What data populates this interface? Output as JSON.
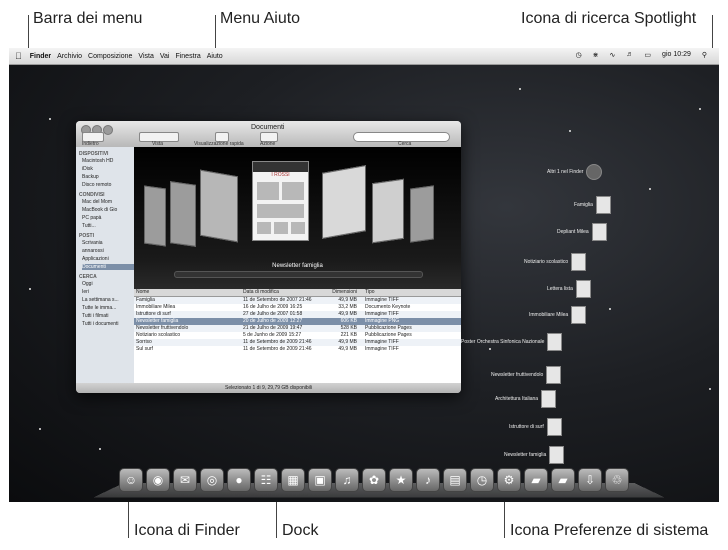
{
  "callouts": {
    "menu_bar": "Barra dei menu",
    "help_menu": "Menu Aiuto",
    "spotlight_icon": "Icona di ricerca Spotlight",
    "finder_icon": "Icona di Finder",
    "dock": "Dock",
    "system_prefs_icon": "Icona Preferenze di sistema"
  },
  "menubar": {
    "apple": "",
    "app": "Finder",
    "items": [
      "Archivio",
      "Composizione",
      "Vista",
      "Vai",
      "Finestra",
      "Aiuto"
    ],
    "clock": "gio 10:29"
  },
  "finder": {
    "title": "Documenti",
    "toolbar": {
      "back_forward": "Indietro",
      "view": "Vista",
      "quicklook": "Visualizzazione rapida",
      "action": "Azione",
      "search": "Cerca"
    },
    "sidebar": {
      "devices_header": "DISPOSITIVI",
      "devices": [
        "Macintosh HD",
        "iDisk",
        "Backup",
        "Disco remoto"
      ],
      "shared_header": "CONDIVISI",
      "shared": [
        "Mac del Mom",
        "MacBook di Gio",
        "PC papà",
        "Tutti..."
      ],
      "places_header": "POSTI",
      "places": [
        "Scrivania",
        "annarossi",
        "Applicazioni",
        "Documenti"
      ],
      "search_header": "CERCA",
      "search": [
        "Oggi",
        "Ieri",
        "La settimana s...",
        "Tutte le imma...",
        "Tutti i filmati",
        "Tutti i documenti"
      ]
    },
    "coverflow": {
      "caption": "Newsletter famiglia",
      "center_heading": "I ROSSI"
    },
    "list": {
      "headers": [
        "Nome",
        "Data di modifica",
        "Dimensioni",
        "Tipo"
      ],
      "rows": [
        [
          "Famiglia",
          "11 de Setembro de 2007 21:46",
          "49,9 MB",
          "Immagine TIFF"
        ],
        [
          "Immobiliare Milea",
          "16 de Julho de 2009 16:25",
          "33,2 MB",
          "Documento Keynote"
        ],
        [
          "Istruttore di surf",
          "27 de Julho de 2007 01:58",
          "49,9 MB",
          "Immagine TIFF"
        ],
        [
          "Newsletter famiglia",
          "20 de Julho de 2009 12:27",
          "606 KB",
          "Immagine PNG"
        ],
        [
          "Newsletter fruttivendolo",
          "21 de Julho de 2009 19:47",
          "528 KB",
          "Pubblicazione Pages"
        ],
        [
          "Notiziario scolastico",
          "5 de Junho de 2009 15:27",
          "221 KB",
          "Pubblicazione Pages"
        ],
        [
          "Sorriso",
          "11 de Setembro de 2009 21:46",
          "49,9 MB",
          "Immagine TIFF"
        ],
        [
          "Sul surf",
          "11 de Setembro de 2009 21:46",
          "49,9 MB",
          "Immagine TIFF"
        ]
      ]
    },
    "status": "Selezionato 1 di 9, 29,79 GB disponibili"
  },
  "stack": {
    "items": [
      "Altri 1 nel Finder",
      "Famiglia",
      "Depliant Milea",
      "Notiziario scolastico",
      "Lettera lista",
      "Immobiliare Milea",
      "Poster Orchestra Sinfonica Nazionale",
      "Newsletter fruttivendolo",
      "Architettura Italiana",
      "Istruttore di surf",
      "Newsletter famiglia"
    ]
  },
  "dock": {
    "icons": [
      "finder-icon",
      "dashboard-icon",
      "mail-icon",
      "safari-icon",
      "ichat-icon",
      "address-book-icon",
      "ical-icon",
      "preview-icon",
      "itunes-icon",
      "iphoto-icon",
      "imovie-icon",
      "garageband-icon",
      "pages-icon",
      "time-machine-icon",
      "system-preferences-icon",
      "applications-folder-icon",
      "documents-folder-icon",
      "downloads-icon",
      "trash-icon"
    ]
  }
}
